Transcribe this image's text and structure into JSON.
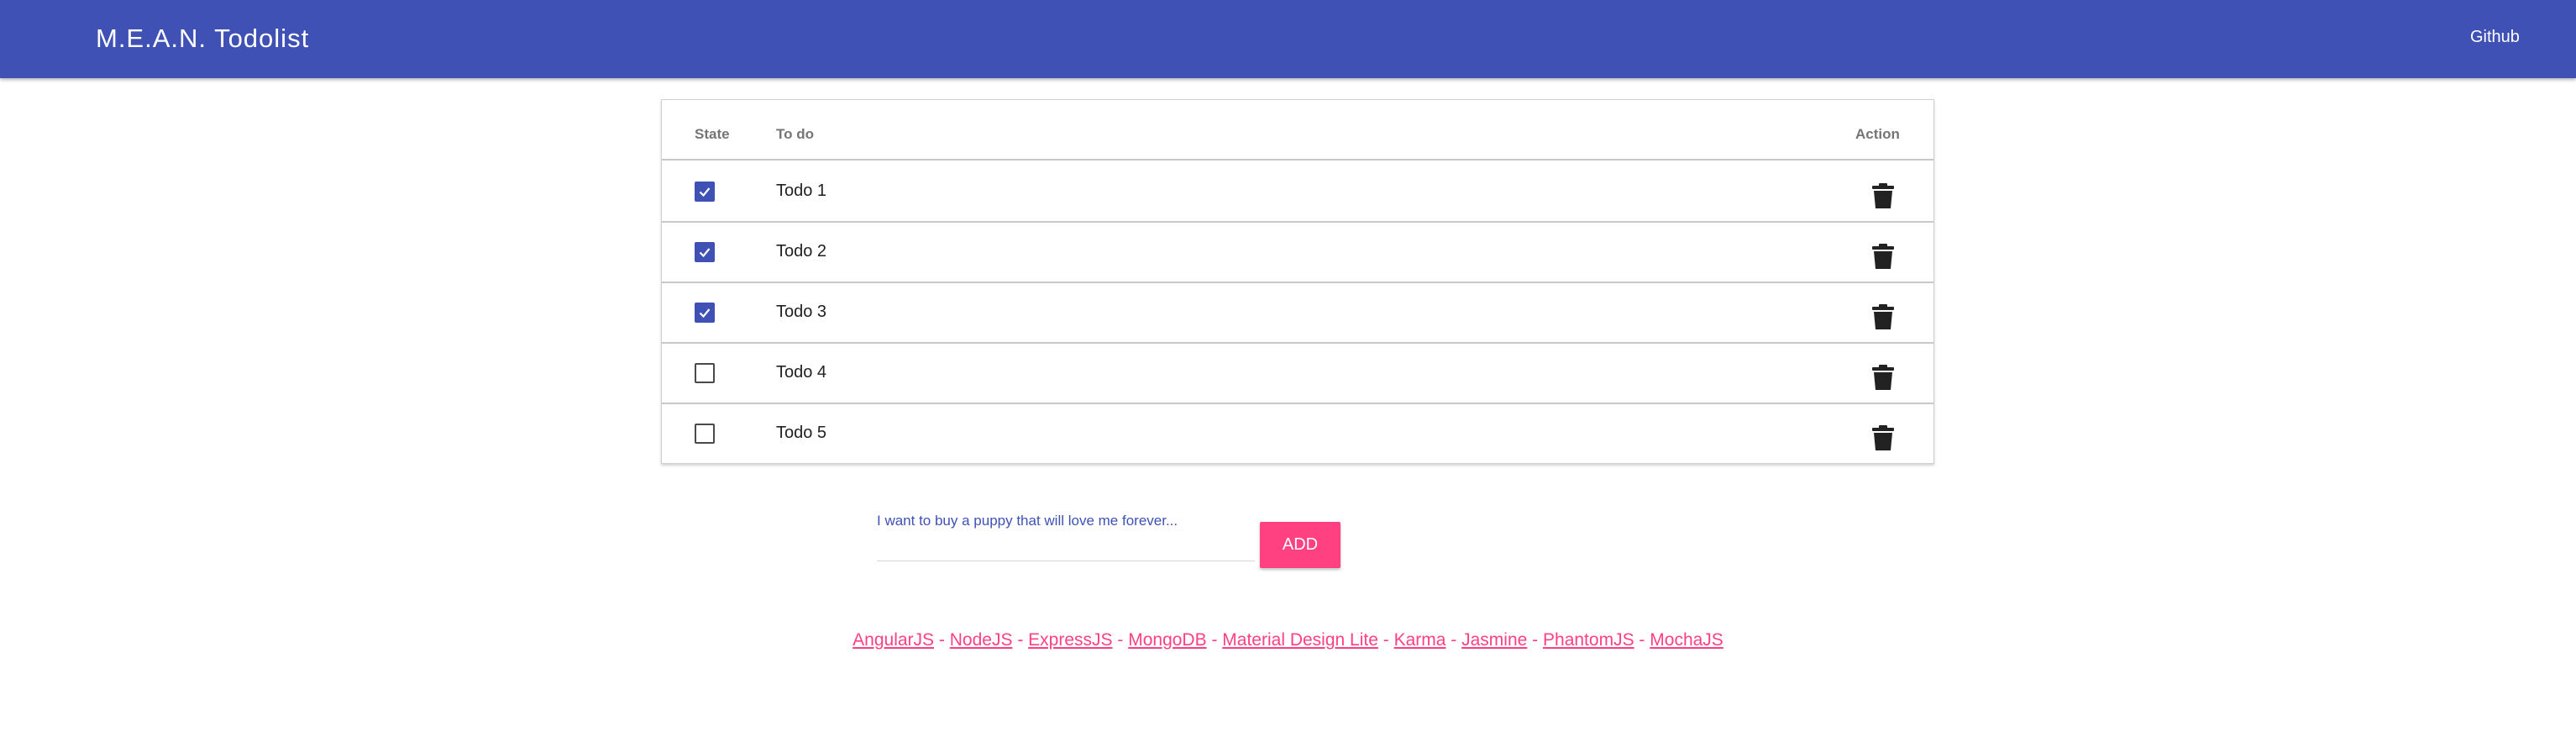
{
  "header": {
    "title": "M.E.A.N. Todolist",
    "github_label": "Github",
    "background": "#3f51b5"
  },
  "table": {
    "columns": [
      "State",
      "To do",
      "Action"
    ],
    "rows": [
      {
        "text": "Todo 1",
        "done": true
      },
      {
        "text": "Todo 2",
        "done": true
      },
      {
        "text": "Todo 3",
        "done": true
      },
      {
        "text": "Todo 4",
        "done": false
      },
      {
        "text": "Todo 5",
        "done": false
      }
    ],
    "action_icon": "trash-icon"
  },
  "add_form": {
    "placeholder": "I want to buy a puppy that will love me forever...",
    "button_label": "ADD",
    "button_color": "#ff4081"
  },
  "footer": {
    "links": [
      "AngularJS",
      "NodeJS",
      "ExpressJS",
      "MongoDB",
      "Material Design Lite",
      "Karma",
      "Jasmine",
      "PhantomJS",
      "MochaJS"
    ],
    "separator": "-",
    "link_color": "#ff4081"
  }
}
